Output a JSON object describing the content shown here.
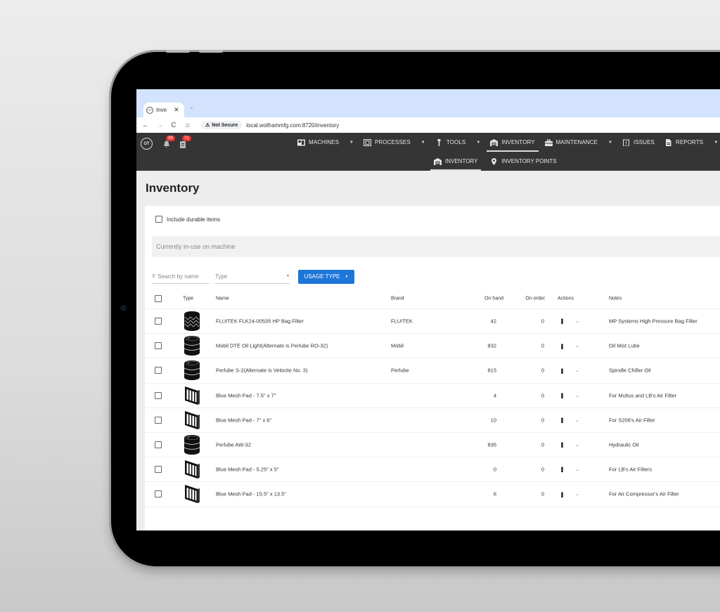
{
  "browser": {
    "tab_title": "Inve",
    "tab_favicon": "OT",
    "close_glyph": "✕",
    "new_tab_glyph": "+",
    "nav": {
      "back": "←",
      "forward": "→",
      "reload": "C",
      "home": "⌂"
    },
    "security_label": "Not Secure",
    "url": "local.wolframmfg.com:8720/inventory"
  },
  "appnav": {
    "logo": "OT",
    "notifications_badge": "39",
    "tasks_badge": "71",
    "menu": [
      {
        "label": "MACHINES",
        "icon": "machines-icon",
        "caret": true
      },
      {
        "label": "PROCESSES",
        "icon": "processes-icon",
        "caret": true
      },
      {
        "label": "TOOLS",
        "icon": "tools-icon",
        "caret": true
      },
      {
        "label": "INVENTORY",
        "icon": "warehouse-icon",
        "caret": false,
        "active": true
      },
      {
        "label": "MAINTENANCE",
        "icon": "toolbox-icon",
        "caret": true
      },
      {
        "label": "ISSUES",
        "icon": "issues-icon",
        "caret": false
      },
      {
        "label": "REPORTS",
        "icon": "reports-icon",
        "caret": true
      }
    ],
    "submenu": [
      {
        "label": "INVENTORY",
        "icon": "warehouse-icon",
        "active": true
      },
      {
        "label": "INVENTORY POINTS",
        "icon": "location-pin-icon"
      }
    ]
  },
  "page": {
    "title": "Inventory",
    "include_durable_label": "Include durable items",
    "include_durable_checked": false,
    "in_use_placeholder": "Currently in-use on machine",
    "search_placeholder": "Search by name",
    "type_placeholder": "Type",
    "usage_type_label": "USAGE TYPE"
  },
  "table": {
    "headers": {
      "type": "Type",
      "name": "Name",
      "brand": "Brand",
      "on_hand": "On hand",
      "on_order": "On order",
      "actions": "Actions",
      "notes": "Notes"
    },
    "rows": [
      {
        "type": "filter-cartridge",
        "name": "FLUITEK FLK24-00535 HP Bag Filter",
        "brand": "FLUITEK",
        "on_hand": "42",
        "on_order": "0",
        "notes": "MP Systems High Pressure Bag Filter"
      },
      {
        "type": "oil-drum",
        "name": "Mobil DTE Oil Light(Alternate is Perlube RO-32)",
        "brand": "Mobil",
        "on_hand": "832",
        "on_order": "0",
        "notes": "Oil Mist Lube"
      },
      {
        "type": "oil-drum",
        "name": "Perlube S-2(Alternate is Velocite No. 3)",
        "brand": "Perlube",
        "on_hand": "815",
        "on_order": "0",
        "notes": "Spindle Chiller Oil"
      },
      {
        "type": "mesh-pad",
        "name": "Blue Mesh Pad - 7.5\" x 7\"",
        "brand": "",
        "on_hand": "4",
        "on_order": "0",
        "notes": "For Multus and LB's Air Filter"
      },
      {
        "type": "mesh-pad",
        "name": "Blue Mesh Pad - 7\" x 6\"",
        "brand": "",
        "on_hand": "10",
        "on_order": "0",
        "notes": "For S206's Air Filter"
      },
      {
        "type": "oil-drum",
        "name": "Perlube AW-32",
        "brand": "",
        "on_hand": "835",
        "on_order": "0",
        "notes": "Hydraulic Oil"
      },
      {
        "type": "mesh-pad",
        "name": "Blue Mesh Pad - 5.25\" x 5\"",
        "brand": "",
        "on_hand": "0",
        "on_order": "0",
        "notes": "For LB's Air Filters"
      },
      {
        "type": "mesh-pad",
        "name": "Blue Mesh Pad - 15.5\" x 13.5\"",
        "brand": "",
        "on_hand": "6",
        "on_order": "0",
        "notes": "For Air Compressor's Air Filter"
      }
    ],
    "kebab_glyph": "•••",
    "expand_glyph": "⌄"
  },
  "colors": {
    "nav_bg": "#353535",
    "accent": "#1e76d8",
    "badge": "#e53935",
    "tabstrip": "#d3e3fd"
  }
}
